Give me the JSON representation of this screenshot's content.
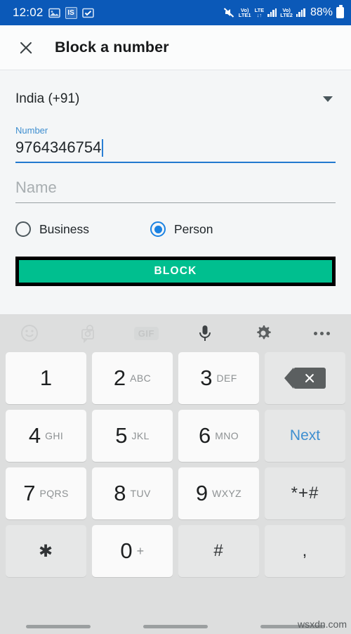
{
  "statusbar": {
    "time": "12:02",
    "icons": [
      "photo-icon",
      "is-badge-icon",
      "check-badge-icon"
    ],
    "is_badge_text": "IS",
    "mute_icon": "mute-icon",
    "sim1": {
      "volte": "Vo)",
      "label": "LTE1"
    },
    "lte_center": "LTE",
    "sim2": {
      "volte": "Vo)",
      "label": "LTE2"
    },
    "battery": "88%",
    "bg_color": "#0b59b8"
  },
  "header": {
    "close_icon": "close-icon",
    "title": "Block a number"
  },
  "form": {
    "country": {
      "value": "India (+91)",
      "caret_icon": "chevron-down-icon"
    },
    "number": {
      "label": "Number",
      "value": "9764346754",
      "accent": "#2279cf"
    },
    "name": {
      "placeholder": "Name",
      "value": ""
    },
    "type_options": [
      {
        "label": "Business",
        "selected": false
      },
      {
        "label": "Person",
        "selected": true
      }
    ],
    "block_button": {
      "label": "BLOCK",
      "bg_color": "#00bf8f",
      "highlight_border": "#000000"
    }
  },
  "keyboard": {
    "toolbar": [
      {
        "name": "emoji-icon",
        "label": ""
      },
      {
        "name": "sticker-icon",
        "label": ""
      },
      {
        "name": "gif-icon",
        "label": "GIF"
      },
      {
        "name": "microphone-icon",
        "label": ""
      },
      {
        "name": "gear-icon",
        "label": ""
      },
      {
        "name": "overflow-menu-icon",
        "label": ""
      }
    ],
    "rows": [
      [
        {
          "num": "1",
          "sub": "",
          "style": "white"
        },
        {
          "num": "2",
          "sub": "ABC",
          "style": "white"
        },
        {
          "num": "3",
          "sub": "DEF",
          "style": "white"
        },
        {
          "num": "",
          "sub": "",
          "style": "grey",
          "icon": "backspace-icon"
        }
      ],
      [
        {
          "num": "4",
          "sub": "GHI",
          "style": "white"
        },
        {
          "num": "5",
          "sub": "JKL",
          "style": "white"
        },
        {
          "num": "6",
          "sub": "MNO",
          "style": "white"
        },
        {
          "num": "",
          "sub": "",
          "style": "grey",
          "text": "Next",
          "accent": "#3f8fd0"
        }
      ],
      [
        {
          "num": "7",
          "sub": "PQRS",
          "style": "white"
        },
        {
          "num": "8",
          "sub": "TUV",
          "style": "white"
        },
        {
          "num": "9",
          "sub": "WXYZ",
          "style": "white"
        },
        {
          "num": "",
          "sub": "",
          "style": "grey",
          "sym": "*+#"
        }
      ],
      [
        {
          "num": "",
          "sub": "",
          "style": "grey",
          "sym": "✱"
        },
        {
          "num": "0",
          "sub": "+",
          "style": "white"
        },
        {
          "num": "",
          "sub": "",
          "style": "grey",
          "sym": "#"
        },
        {
          "num": "",
          "sub": "",
          "style": "grey",
          "sym": ","
        }
      ]
    ]
  },
  "navbar": {
    "items": [
      "nav-recents",
      "nav-home",
      "nav-back"
    ],
    "watermark": "wsxdn.com"
  }
}
